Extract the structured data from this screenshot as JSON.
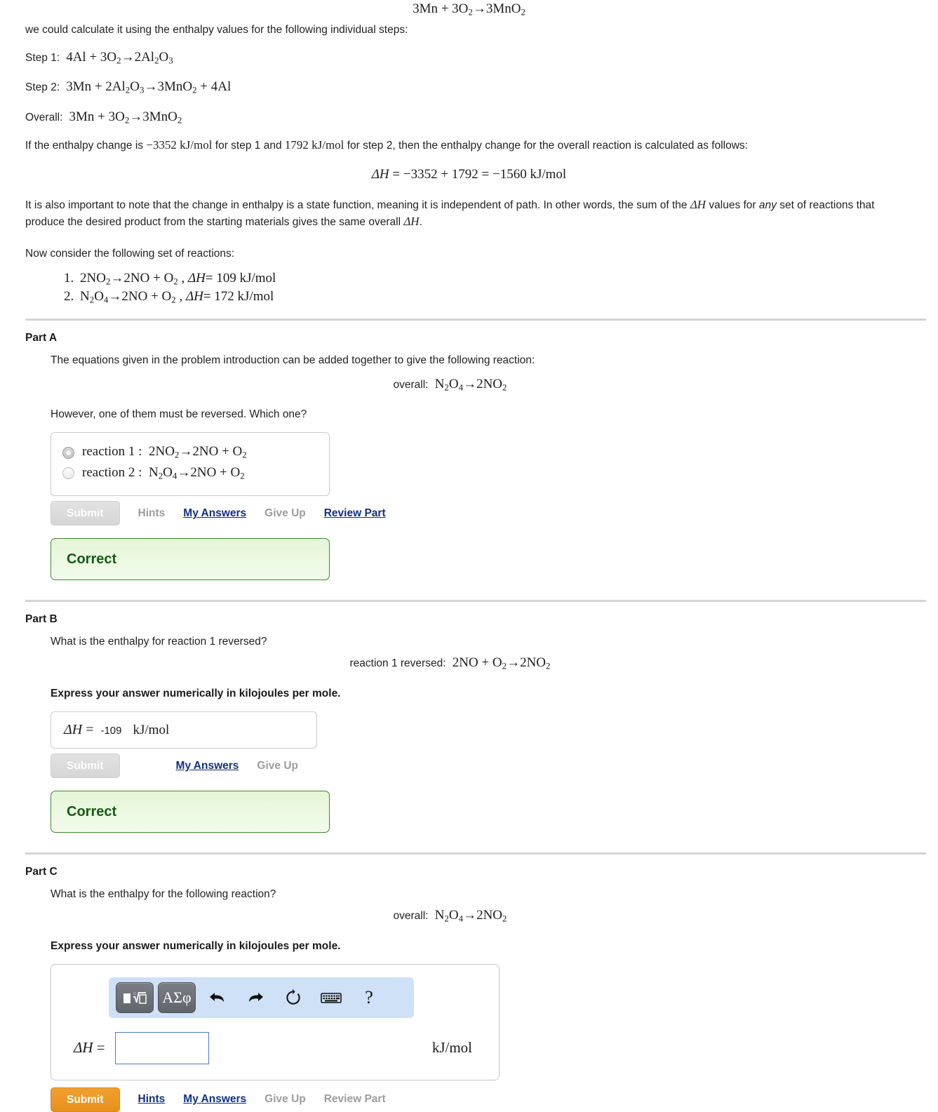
{
  "intro": {
    "top_equation": "3Mn + 3O2 → 3MnO2",
    "lead_text": "we could calculate it using the enthalpy values for the following individual steps:",
    "step1_label": "Step 1:",
    "step1_equation": "4Al + 3O2 → 2Al2O3",
    "step2_label": "Step 2:",
    "step2_equation": "3Mn + 2Al2O3 → 3MnO2 + 4Al",
    "overall_label": "Overall:",
    "overall_equation": "3Mn + 3O2 → 3MnO2",
    "enthalpy_sentence_a": "If the enthalpy change is ",
    "enthalpy_value_1": "−3352 kJ/mol",
    "enthalpy_sentence_b": " for step 1 and ",
    "enthalpy_value_2": "1792 kJ/mol",
    "enthalpy_sentence_c": " for step 2, then the enthalpy change for the overall reaction is calculated as follows:",
    "result_equation": "ΔH = −3352 + 1792 = −1560 kJ/mol",
    "state_function_a": "It is also important to note that the change in enthalpy is a state function, meaning it is independent of path. In other words, the sum of the ",
    "state_function_dh1": "ΔH",
    "state_function_b": " values for ",
    "state_function_any": "any",
    "state_function_c": " set of reactions that produce the desired product from the starting materials gives the same overall ",
    "state_function_dh2": "ΔH",
    "state_function_d": ".",
    "now_consider": "Now consider the following set of reactions:",
    "reactions": [
      {
        "equation": "2NO2 → 2NO + O2",
        "delta_h": "ΔH = 109 kJ/mol"
      },
      {
        "equation": "N2O4 → 2NO + O2",
        "delta_h": "ΔH = 172 kJ/mol"
      }
    ]
  },
  "part_a": {
    "title": "Part A",
    "question": "The equations given in the problem introduction can be added together to give the following reaction:",
    "equation_prefix": "overall:",
    "equation": "N2O4 → 2NO2",
    "follow_up": "However, one of them must be reversed. Which one?",
    "choices": [
      {
        "label": "reaction 1 :",
        "equation": "2NO2 → 2NO + O2",
        "selected": true
      },
      {
        "label": "reaction 2 :",
        "equation": "N2O4 → 2NO + O2",
        "selected": false
      }
    ],
    "submit_label": "Submit",
    "hints_label": "Hints",
    "my_answers_label": "My Answers",
    "give_up_label": "Give Up",
    "review_part_label": "Review Part",
    "feedback": "Correct"
  },
  "part_b": {
    "title": "Part B",
    "question": "What is the enthalpy for reaction 1 reversed?",
    "equation_prefix": "reaction 1 reversed:",
    "equation": "2NO + O2 → 2NO2",
    "instruction": "Express your answer numerically in kilojoules per mole.",
    "answer_label": "ΔH =",
    "answer_value": "-109",
    "answer_unit": "kJ/mol",
    "submit_label": "Submit",
    "my_answers_label": "My Answers",
    "give_up_label": "Give Up",
    "feedback": "Correct"
  },
  "part_c": {
    "title": "Part C",
    "question": "What is the enthalpy for the following reaction?",
    "equation_prefix": "overall:",
    "equation": "N2O4 → 2NO2",
    "instruction": "Express your answer numerically in kilojoules per mole.",
    "toolbar": {
      "template_button": "math-template",
      "greek_button": "ΑΣφ",
      "undo": "undo-arrow",
      "redo": "redo-arrow",
      "reset": "reset-circle",
      "keyboard": "keyboard",
      "help": "?"
    },
    "answer_label": "ΔH =",
    "answer_value": "",
    "answer_unit": "kJ/mol",
    "submit_label": "Submit",
    "hints_label": "Hints",
    "my_answers_label": "My Answers",
    "give_up_label": "Give Up",
    "review_part_label": "Review Part"
  },
  "colors": {
    "link": "#11307e",
    "muted": "#9d9d9d",
    "submit_active": "#e8901c",
    "correct_border": "#3d8b27",
    "correct_text": "#165a16",
    "toolbar_bg": "#cfe1f7"
  }
}
